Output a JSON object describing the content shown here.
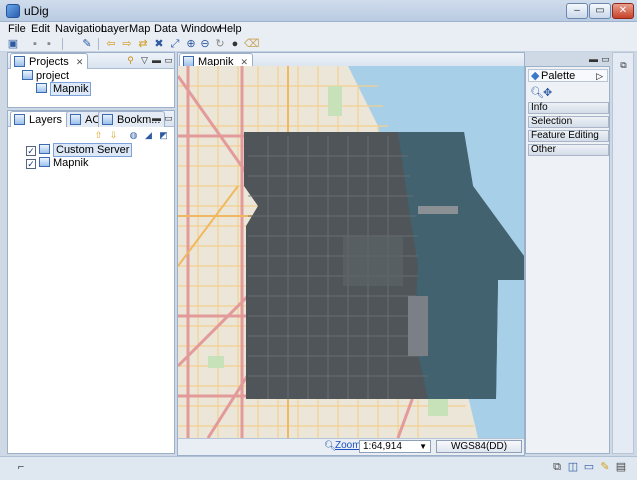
{
  "window": {
    "title": "uDig",
    "controls": [
      "‒",
      "▭",
      "✕"
    ]
  },
  "menu": [
    "File",
    "Edit",
    "Navigation",
    "Layer",
    "Map",
    "Data",
    "Window",
    "Help"
  ],
  "projects_view": {
    "tab_label": "Projects",
    "tree": [
      {
        "label": "project"
      },
      {
        "label": "Mapnik"
      }
    ]
  },
  "layers_view": {
    "tabs": [
      "Layers",
      "AOI",
      "Bookm..."
    ],
    "layers": [
      {
        "label": "Custom Server",
        "checked": true,
        "selected": true
      },
      {
        "label": "Mapnik",
        "checked": true,
        "selected": false
      }
    ]
  },
  "map_editor": {
    "tab_label": "Mapnik"
  },
  "palette": {
    "title": "Palette",
    "groups": [
      "Info",
      "Selection",
      "Feature Editing",
      "Other"
    ]
  },
  "map_status": {
    "zoom_label": "Zoom",
    "scale_value": "1:64,914",
    "crs_label": "WGS84(DD)"
  },
  "colors": {
    "water": "#a7cfe8",
    "land": "#ebe6d7",
    "road_major": "#e8a0a0",
    "road_minor": "#f5d79a",
    "imagery": "#4a4f52"
  }
}
